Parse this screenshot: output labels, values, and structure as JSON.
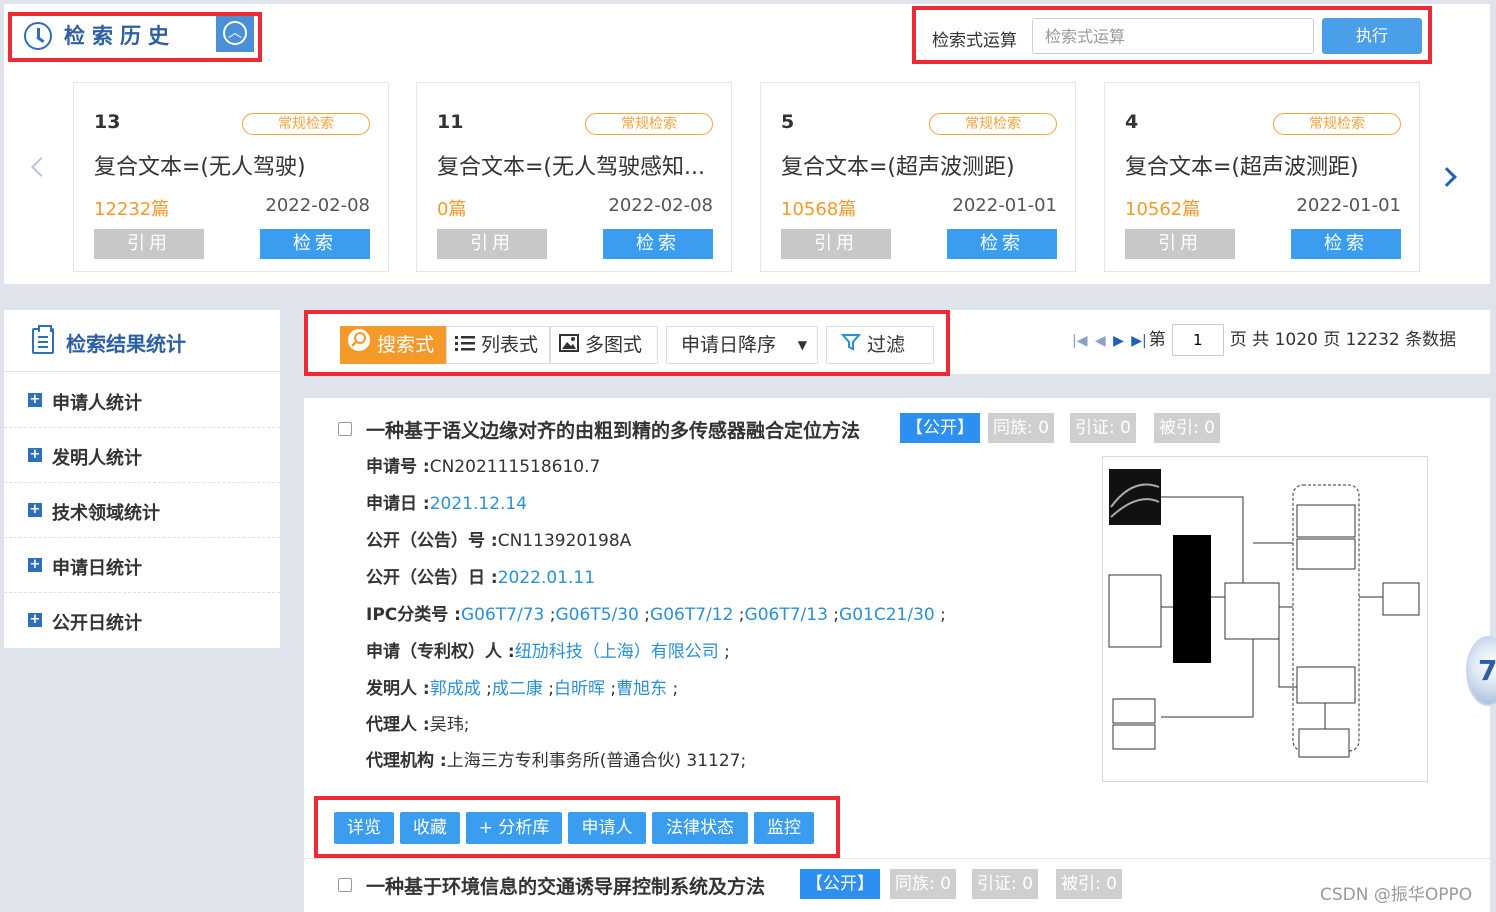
{
  "history": {
    "title": "检索历史",
    "formula_label": "检索式运算",
    "formula_placeholder": "检索式运算",
    "execute_label": "执行",
    "cards": [
      {
        "num": "13",
        "tag": "常规检索",
        "query": "复合文本=(无人驾驶)",
        "count": "12232篇",
        "date": "2022-02-08",
        "cite": "引用",
        "search": "检索"
      },
      {
        "num": "11",
        "tag": "常规检索",
        "query": "复合文本=(无人驾驶感知...",
        "count": "0篇",
        "date": "2022-02-08",
        "cite": "引用",
        "search": "检索"
      },
      {
        "num": "5",
        "tag": "常规检索",
        "query": "复合文本=(超声波测距)",
        "count": "10568篇",
        "date": "2022-01-01",
        "cite": "引用",
        "search": "检索"
      },
      {
        "num": "4",
        "tag": "常规检索",
        "query": "复合文本=(超声波测距)",
        "count": "10562篇",
        "date": "2022-01-01",
        "cite": "引用",
        "search": "检索"
      }
    ]
  },
  "stats": {
    "title": "检索结果统计",
    "items": [
      "申请人统计",
      "发明人统计",
      "技术领域统计",
      "申请日统计",
      "公开日统计"
    ]
  },
  "toolbar": {
    "views": [
      "搜索式",
      "列表式",
      "多图式"
    ],
    "sort": "申请日降序",
    "filter": "过滤",
    "pager": {
      "prefix": "第",
      "page": "1",
      "middle": "页 共",
      "total_pages": "1020",
      "middle2": "页",
      "total_records": "12232",
      "suffix": "条数据"
    }
  },
  "results": [
    {
      "title": "一种基于语义边缘对齐的由粗到精的多传感器融合定位方法",
      "status": "【公开】",
      "family": "同族: 0",
      "cite": "引证: 0",
      "cited": "被引: 0",
      "app_no_label": "申请号 :",
      "app_no": "CN202111518610.7",
      "app_date_label": "申请日 :",
      "app_date": "2021.12.14",
      "pub_no_label": "公开（公告）号 :",
      "pub_no": "CN113920198A",
      "pub_date_label": "公开（公告）日 :",
      "pub_date": "2022.01.11",
      "ipc_label": "IPC分类号 :",
      "ipc": [
        "G06T7/73",
        "G06T5/30",
        "G06T7/12",
        "G06T7/13",
        "G01C21/30"
      ],
      "applicant_label": "申请（专利权）人 :",
      "applicant": "纽劢科技（上海）有限公司",
      "inventor_label": "发明人 :",
      "inventors": [
        "郭成成",
        "成二康",
        "白昕晖",
        "曹旭东"
      ],
      "agent_label": "代理人 :",
      "agent": "吴玮;",
      "agency_label": "代理机构 :",
      "agency": "上海三方专利事务所(普通合伙) 31127;",
      "actions": [
        "详览",
        "收藏",
        "+ 分析库",
        "申请人",
        "法律状态",
        "监控"
      ]
    },
    {
      "title": "一种基于环境信息的交通诱导屏控制系统及方法",
      "status": "【公开】",
      "family": "同族: 0",
      "cite": "引证: 0",
      "cited": "被引: 0"
    }
  ],
  "watermark": "CSDN @振华OPPO",
  "float_badge": "7"
}
